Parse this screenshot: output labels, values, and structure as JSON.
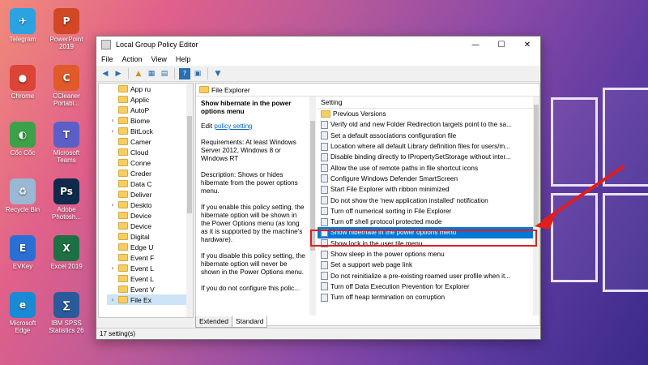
{
  "desktop": {
    "icons": [
      {
        "label": "Telegram",
        "color": "#2aa3e0",
        "glyph": "✈"
      },
      {
        "label": "PowerPoint 2019",
        "color": "#d24726",
        "glyph": "P"
      },
      {
        "label": "Chrome",
        "color": "#db4437",
        "glyph": "●"
      },
      {
        "label": "CCleaner Portabl...",
        "color": "#e05a2a",
        "glyph": "C"
      },
      {
        "label": "Cốc Cốc",
        "color": "#3da14a",
        "glyph": "◐"
      },
      {
        "label": "Microsoft Teams",
        "color": "#5b5fc7",
        "glyph": "T"
      },
      {
        "label": "Recycle Bin",
        "color": "#9ab7d4",
        "glyph": "♻"
      },
      {
        "label": "Adobe Photosh...",
        "color": "#0f2a4a",
        "glyph": "Ps"
      },
      {
        "label": "EVKey",
        "color": "#2a6fd4",
        "glyph": "E"
      },
      {
        "label": "Excel 2019",
        "color": "#1d7044",
        "glyph": "X"
      },
      {
        "label": "Microsoft Edge",
        "color": "#1a8ad4",
        "glyph": "e"
      },
      {
        "label": "IBM SPSS Statistics 26",
        "color": "#2a5a9a",
        "glyph": "∑"
      }
    ]
  },
  "window": {
    "title": "Local Group Policy Editor",
    "menu": [
      "File",
      "Action",
      "View",
      "Help"
    ],
    "controls": {
      "minimize": "—",
      "maximize": "☐",
      "close": "✕"
    }
  },
  "tree": {
    "items": [
      {
        "label": "App ru",
        "expandable": false
      },
      {
        "label": "Applic",
        "expandable": false
      },
      {
        "label": "AutoP",
        "expandable": false
      },
      {
        "label": "Biome",
        "expandable": true
      },
      {
        "label": "BitLock",
        "expandable": true
      },
      {
        "label": "Camer",
        "expandable": false
      },
      {
        "label": "Cloud",
        "expandable": false
      },
      {
        "label": "Conne",
        "expandable": false
      },
      {
        "label": "Creder",
        "expandable": false
      },
      {
        "label": "Data C",
        "expandable": false
      },
      {
        "label": "Deliver",
        "expandable": false
      },
      {
        "label": "Deskto",
        "expandable": true
      },
      {
        "label": "Device",
        "expandable": false
      },
      {
        "label": "Device",
        "expandable": false
      },
      {
        "label": "Digital",
        "expandable": false
      },
      {
        "label": "Edge U",
        "expandable": false
      },
      {
        "label": "Event F",
        "expandable": false
      },
      {
        "label": "Event L",
        "expandable": true
      },
      {
        "label": "Event L",
        "expandable": false
      },
      {
        "label": "Event V",
        "expandable": false
      },
      {
        "label": "File Ex",
        "expandable": true,
        "selected": true
      }
    ]
  },
  "panel": {
    "header": "File Explorer",
    "description": {
      "title": "Show hibernate in the power options menu",
      "edit_prefix": "Edit ",
      "edit_link": "policy setting",
      "requirements": "Requirements: At least Windows Server 2012, Windows 8 or Windows RT",
      "description_text": "Description: Shows or hides hibernate from the power options menu.",
      "enable_text": "If you enable this policy setting, the hibernate option will be shown in the Power Options menu (as long as it is supported by the machine's hardware).",
      "disable_text": "If you disable this policy setting, the hibernate option will never be shown in the Power Options menu.",
      "notconfig_text": "If you do not configure this polic..."
    },
    "list": {
      "column_header": "Setting",
      "items": [
        {
          "label": "Previous Versions",
          "type": "folder"
        },
        {
          "label": "Verify old and new Folder Redirection targets point to the sa..."
        },
        {
          "label": "Set a default associations configuration file"
        },
        {
          "label": "Location where all default Library definition files for users/m..."
        },
        {
          "label": "Disable binding directly to IPropertySetStorage without inter..."
        },
        {
          "label": "Allow the use of remote paths in file shortcut icons"
        },
        {
          "label": "Configure Windows Defender SmartScreen"
        },
        {
          "label": "Start File Explorer with ribbon minimized"
        },
        {
          "label": "Do not show the 'new application installed' notification"
        },
        {
          "label": "Turn off numerical sorting in File Explorer"
        },
        {
          "label": "Turn off shell protocol protected mode"
        },
        {
          "label": "Show hibernate in the power options menu",
          "selected": true
        },
        {
          "label": "Show lock in the user tile menu"
        },
        {
          "label": "Show sleep in the power options menu"
        },
        {
          "label": "Set a support web page link"
        },
        {
          "label": "Do not reinitialize a pre-existing roamed user profile when it..."
        },
        {
          "label": "Turn off Data Execution Prevention for Explorer"
        },
        {
          "label": "Turn off heap termination on corruption"
        }
      ]
    },
    "tabs": [
      "Extended",
      "Standard"
    ]
  },
  "status": "17 setting(s)",
  "accent": "#0078d7",
  "highlight_color": "#e01e1e"
}
